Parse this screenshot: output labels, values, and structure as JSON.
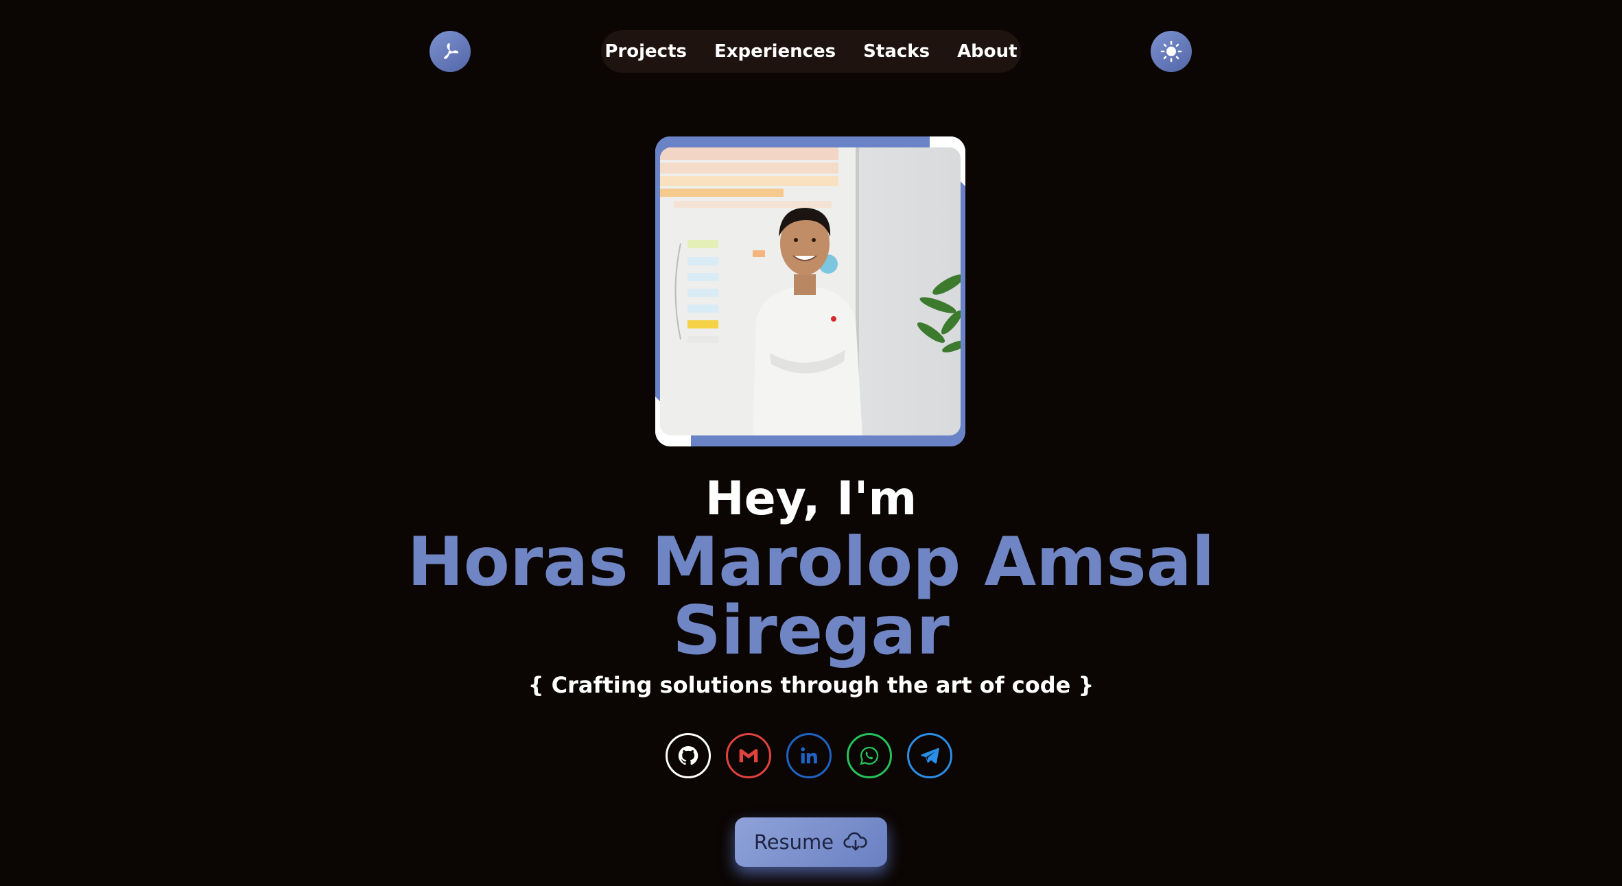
{
  "nav": {
    "logo_icon": "asterisk-logo-icon",
    "items": [
      {
        "label": "Projects"
      },
      {
        "label": "Experiences"
      },
      {
        "label": "Stacks"
      },
      {
        "label": "About"
      }
    ],
    "theme_icon": "sun-icon"
  },
  "hero": {
    "photo_icon": "profile-photo",
    "greeting": "Hey, I'm",
    "name_line1": "Horas Marolop Amsal",
    "name_line2": "Siregar",
    "tagline": "{ Crafting solutions through the art of code }"
  },
  "socials": [
    {
      "icon": "github-icon",
      "color": "#ffffff"
    },
    {
      "icon": "gmail-icon",
      "color": "#e0423d"
    },
    {
      "icon": "linkedin-icon",
      "color": "#1f63c4"
    },
    {
      "icon": "whatsapp-icon",
      "color": "#25c25a"
    },
    {
      "icon": "telegram-icon",
      "color": "#2a8ee6"
    }
  ],
  "resume": {
    "label": "Resume",
    "icon": "cloud-download-icon"
  },
  "colors": {
    "background": "#0b0604",
    "accent": "#7085c4",
    "nav_bg": "#1e130f"
  }
}
